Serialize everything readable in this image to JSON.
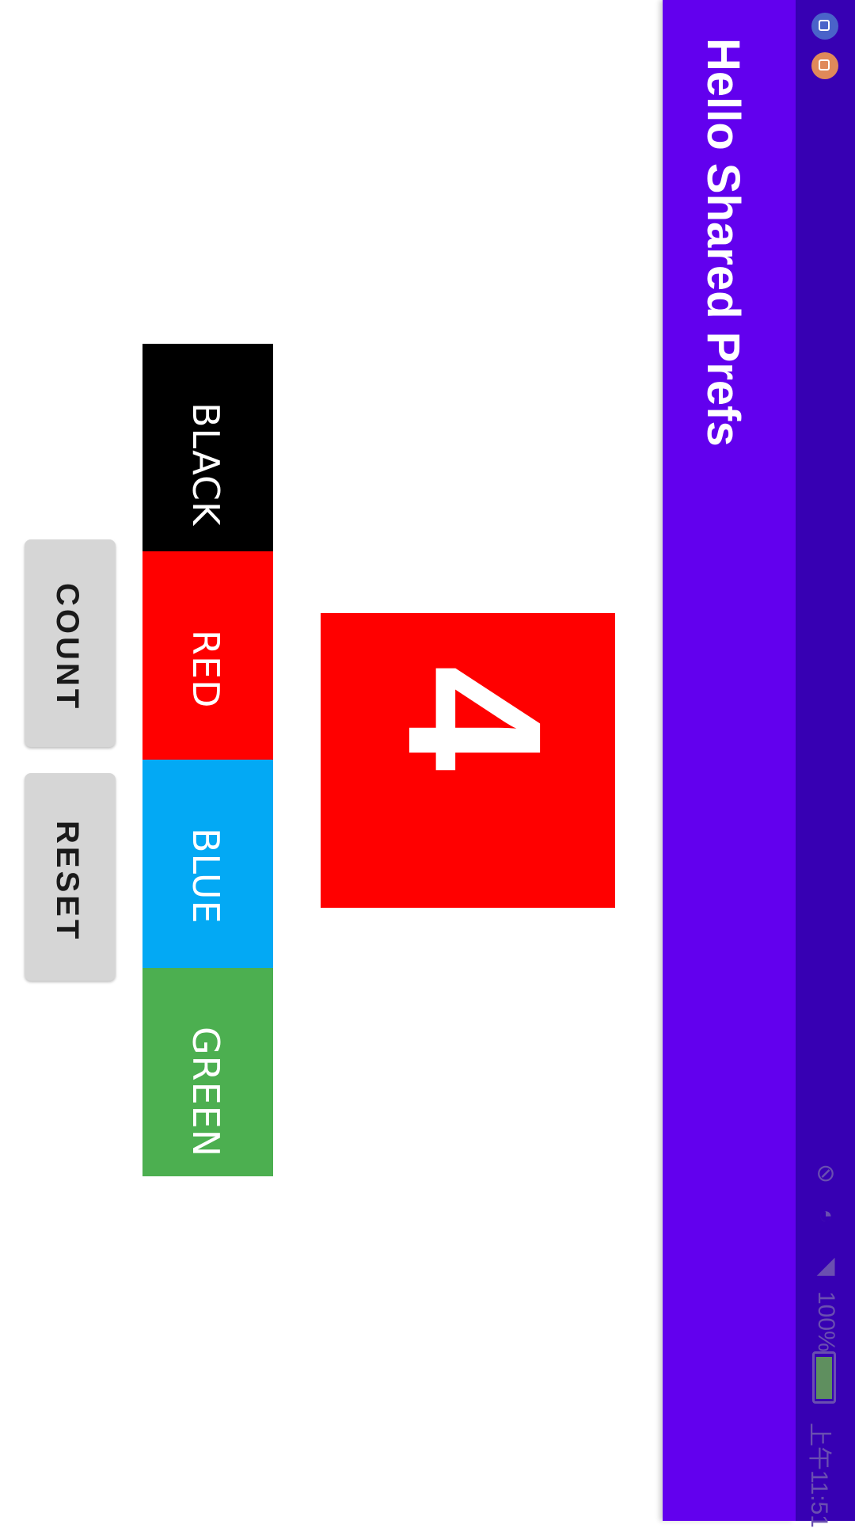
{
  "status_bar": {
    "battery_percent": "100%",
    "carrier": "上午11:51",
    "icons": [
      "app-notification-icon",
      "app-notification-icon",
      "mute-icon",
      "wifi-icon",
      "signal-icon",
      "battery-icon"
    ]
  },
  "app_bar": {
    "title": "Hello Shared Prefs"
  },
  "counter": {
    "value": "4",
    "background": "#ff0000"
  },
  "color_buttons": [
    {
      "label": "BLACK",
      "color": "#000000"
    },
    {
      "label": "RED",
      "color": "#ff0000"
    },
    {
      "label": "BLUE",
      "color": "#03a9f4"
    },
    {
      "label": "GREEN",
      "color": "#4caf50"
    }
  ],
  "actions": {
    "count_label": "COUNT",
    "reset_label": "RESET"
  },
  "colors": {
    "primary": "#6200ee",
    "primary_dark": "#3700b3"
  }
}
